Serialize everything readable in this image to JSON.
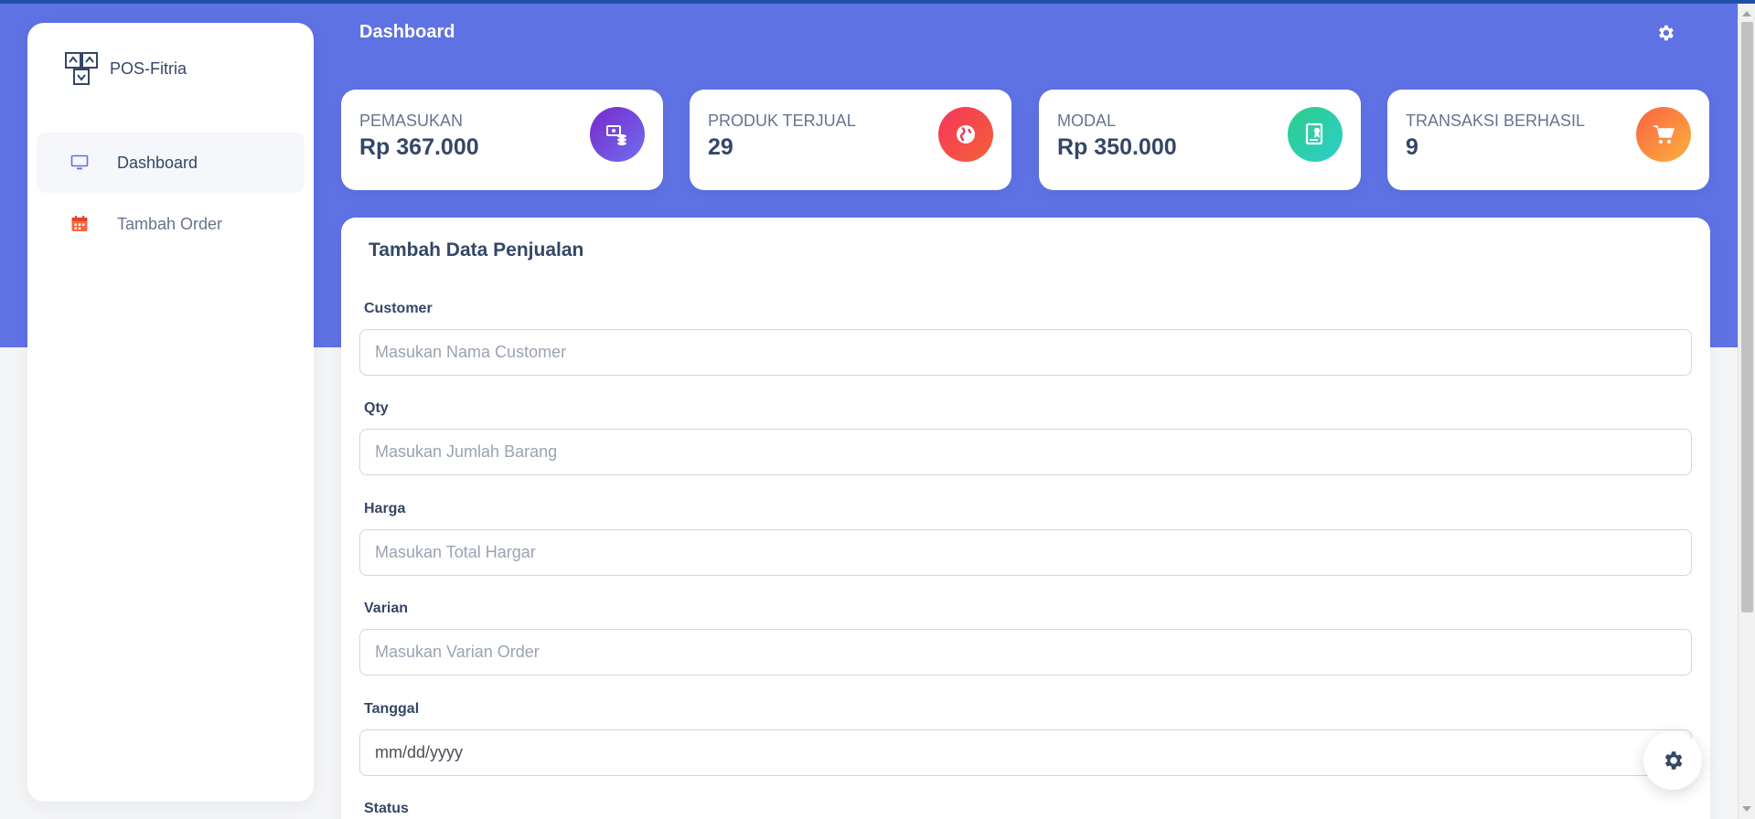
{
  "app": {
    "brand_name": "POS-Fitria",
    "page_title": "Dashboard"
  },
  "sidebar": {
    "items": [
      {
        "label": "Dashboard",
        "icon": "monitor-icon",
        "active": true
      },
      {
        "label": "Tambah Order",
        "icon": "calendar-icon",
        "active": false
      }
    ]
  },
  "stats": [
    {
      "label": "PEMASUKAN",
      "value": "Rp 367.000",
      "icon": "money-coins-icon",
      "color": "#7c5ce6"
    },
    {
      "label": "PRODUK TERJUAL",
      "value": "29",
      "icon": "world-icon",
      "color": "#f5365c"
    },
    {
      "label": "MODAL",
      "value": "Rp 350.000",
      "icon": "paper-diploma-icon",
      "color": "#2dce89"
    },
    {
      "label": "TRANSAKSI BERHASIL",
      "value": "9",
      "icon": "cart-icon",
      "color": "#fb6340"
    }
  ],
  "form": {
    "title": "Tambah Data Penjualan",
    "fields": [
      {
        "label": "Customer",
        "placeholder": "Masukan Nama Customer"
      },
      {
        "label": "Qty",
        "placeholder": "Masukan Jumlah Barang"
      },
      {
        "label": "Harga",
        "placeholder": "Masukan Total Hargar"
      },
      {
        "label": "Varian",
        "placeholder": "Masukan Varian Order"
      },
      {
        "label": "Tanggal",
        "placeholder": "mm/dd/yyyy"
      },
      {
        "label": "Status",
        "placeholder": ""
      }
    ]
  },
  "colors": {
    "header_bg": "#5e72e4",
    "text_dark": "#344767"
  }
}
